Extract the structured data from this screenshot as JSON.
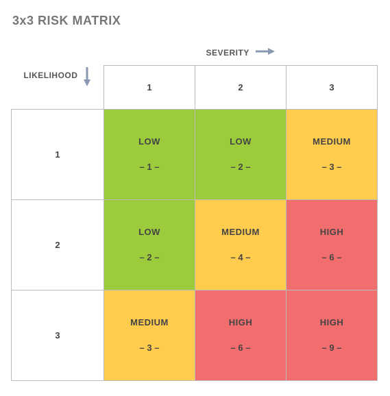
{
  "title": "3x3 RISK MATRIX",
  "axis": {
    "severity_label": "SEVERITY",
    "likelihood_label": "LIKELIHOOD",
    "severity_levels": [
      "1",
      "2",
      "3"
    ],
    "likelihood_levels": [
      "1",
      "2",
      "3"
    ]
  },
  "colors": {
    "low": "#9ccc3c",
    "medium": "#ffcc4d",
    "high": "#f26d6d"
  },
  "cells": {
    "r1c1": {
      "rating": "LOW",
      "score": "– 1 –"
    },
    "r1c2": {
      "rating": "LOW",
      "score": "– 2 –"
    },
    "r1c3": {
      "rating": "MEDIUM",
      "score": "– 3 –"
    },
    "r2c1": {
      "rating": "LOW",
      "score": "– 2 –"
    },
    "r2c2": {
      "rating": "MEDIUM",
      "score": "– 4 –"
    },
    "r2c3": {
      "rating": "HIGH",
      "score": "– 6 –"
    },
    "r3c1": {
      "rating": "MEDIUM",
      "score": "– 3 –"
    },
    "r3c2": {
      "rating": "HIGH",
      "score": "– 6 –"
    },
    "r3c3": {
      "rating": "HIGH",
      "score": "– 9 –"
    }
  },
  "chart_data": {
    "type": "heatmap",
    "title": "3x3 RISK MATRIX",
    "xlabel": "SEVERITY",
    "ylabel": "LIKELIHOOD",
    "x_categories": [
      1,
      2,
      3
    ],
    "y_categories": [
      1,
      2,
      3
    ],
    "values": [
      [
        1,
        2,
        3
      ],
      [
        2,
        4,
        6
      ],
      [
        3,
        6,
        9
      ]
    ],
    "ratings": [
      [
        "LOW",
        "LOW",
        "MEDIUM"
      ],
      [
        "LOW",
        "MEDIUM",
        "HIGH"
      ],
      [
        "MEDIUM",
        "HIGH",
        "HIGH"
      ]
    ],
    "legend": {
      "LOW": "#9ccc3c",
      "MEDIUM": "#ffcc4d",
      "HIGH": "#f26d6d"
    }
  }
}
